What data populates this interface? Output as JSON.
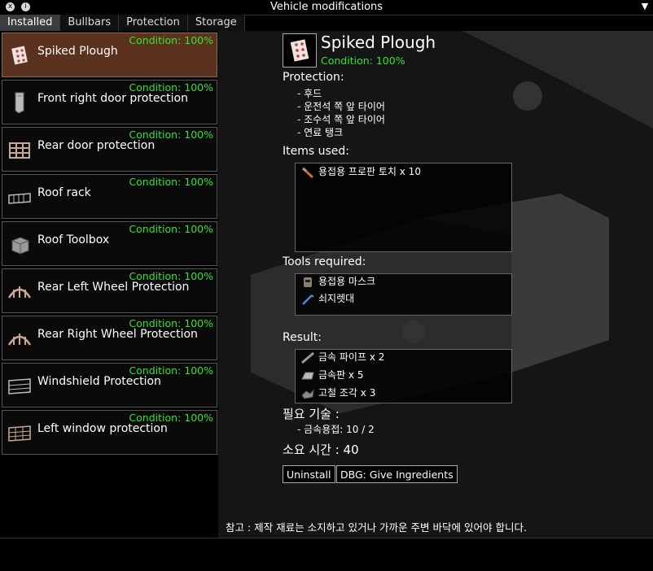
{
  "window": {
    "title": "Vehicle modifications",
    "close_icon": "x",
    "info_icon": "i",
    "corner_icon": "▼"
  },
  "tabs": [
    {
      "label": "Installed",
      "active": true
    },
    {
      "label": "Bullbars",
      "active": false
    },
    {
      "label": "Protection",
      "active": false
    },
    {
      "label": "Storage",
      "active": false
    }
  ],
  "mods": [
    {
      "label": "Spiked Plough",
      "condition": "Condition: 100%",
      "icon": "spiked-plough-icon"
    },
    {
      "label": "Front right door protection",
      "condition": "Condition: 100%",
      "icon": "door-protection-icon"
    },
    {
      "label": "Rear door protection",
      "condition": "Condition: 100%",
      "icon": "rear-door-icon"
    },
    {
      "label": "Roof rack",
      "condition": "Condition: 100%",
      "icon": "roof-rack-icon"
    },
    {
      "label": "Roof Toolbox",
      "condition": "Condition: 100%",
      "icon": "toolbox-icon"
    },
    {
      "label": "Rear Left Wheel Protection",
      "condition": "Condition: 100%",
      "icon": "wheel-protection-icon"
    },
    {
      "label": "Rear Right Wheel Protection",
      "condition": "Condition: 100%",
      "icon": "wheel-protection-icon"
    },
    {
      "label": "Windshield Protection",
      "condition": "Condition: 100%",
      "icon": "windshield-icon"
    },
    {
      "label": "Left window protection",
      "condition": "Condition: 100%",
      "icon": "window-protection-icon"
    }
  ],
  "detail": {
    "title": "Spiked Plough",
    "condition": "Condition: 100%",
    "protection_label": "Protection:",
    "protection": [
      "- 후드",
      "- 운전석 쪽 앞 타이어",
      "- 조수석 쪽 앞 타이어",
      "- 연료 탱크"
    ],
    "items_used_label": "Items used:",
    "items_used": [
      {
        "text": "용접용 프로판 토치 x 10",
        "icon": "propane-torch-icon"
      }
    ],
    "tools_label": "Tools required:",
    "tools": [
      {
        "text": "용접용 마스크",
        "icon": "welding-mask-icon"
      },
      {
        "text": "쇠지렛대",
        "icon": "crowbar-icon"
      }
    ],
    "result_label": "Result:",
    "results": [
      {
        "text": "금속 파이프 x 2",
        "icon": "metal-pipe-icon"
      },
      {
        "text": "금속판 x 5",
        "icon": "metal-sheet-icon"
      },
      {
        "text": "고철 조각 x 3",
        "icon": "scrap-metal-icon"
      }
    ],
    "skills_label": "필요 기술 :",
    "skills": [
      "- 금속용접: 10 / 2"
    ],
    "time_label": "소요 시간 : 40",
    "uninstall_label": "Uninstall",
    "dbg_label": "DBG: Give Ingredients",
    "note": "참고 : 제작 재료는 소지하고 있거나 가까운 주변 바닥에 있어야 합니다."
  },
  "colors": {
    "condition_green": "#2ee62e",
    "selected_bg": "#5a321d",
    "active_tab_bg": "#3d3d3d"
  }
}
